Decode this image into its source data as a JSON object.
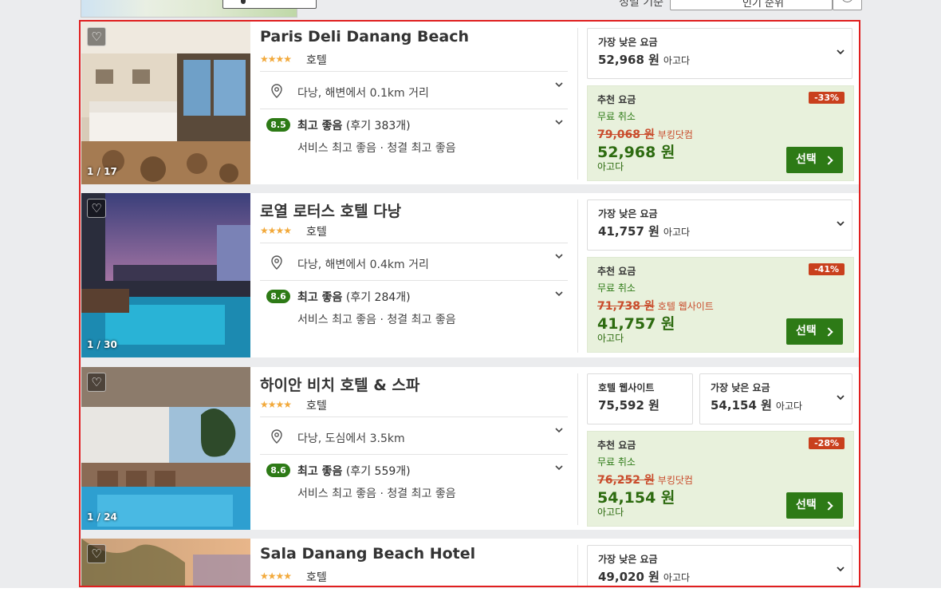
{
  "topbar": {
    "map_button_label": "지도에서 보기",
    "sort_label": "정렬 기준",
    "sort_value": "인기 순위"
  },
  "hotels": [
    {
      "name": "Paris Deli Danang Beach",
      "stars": "★★★★",
      "type": "호텔",
      "photo_counter": "1 / 17",
      "location": "다낭, 해변에서 0.1km 거리",
      "score": "8.5",
      "rating_text": "최고 좋음",
      "review_count": "(후기 383개)",
      "sub_rating": "서비스 최고 좋음 · 청결 최고 좋음",
      "lowest_label": "가장 낮은 요금",
      "lowest_price": "52,968 원",
      "lowest_site": "아고다",
      "rec_label": "추천 요금",
      "discount": "-33%",
      "free_cancel": "무료 취소",
      "old_price": "79,068 원",
      "old_site": "부킹닷컴",
      "price": "52,968 원",
      "site": "아고다",
      "select_label": "선택"
    },
    {
      "name": "로열 로터스 호텔 다낭",
      "stars": "★★★★",
      "type": "호텔",
      "photo_counter": "1 / 30",
      "location": "다낭, 해변에서 0.4km 거리",
      "score": "8.6",
      "rating_text": "최고 좋음",
      "review_count": "(후기 284개)",
      "sub_rating": "서비스 최고 좋음 · 청결 최고 좋음",
      "lowest_label": "가장 낮은 요금",
      "lowest_price": "41,757 원",
      "lowest_site": "아고다",
      "rec_label": "추천 요금",
      "discount": "-41%",
      "free_cancel": "무료 취소",
      "old_price": "71,738 원",
      "old_site": "호텔 웹사이트",
      "price": "41,757 원",
      "site": "아고다",
      "select_label": "선택"
    },
    {
      "name": "하이안 비치 호텔 & 스파",
      "stars": "★★★★",
      "type": "호텔",
      "photo_counter": "1 / 24",
      "location": "다낭, 도심에서 3.5km",
      "score": "8.6",
      "rating_text": "최고 좋음",
      "review_count": "(후기 559개)",
      "sub_rating": "서비스 최고 좋음 · 청결 최고 좋음",
      "site_label": "호텔 웹사이트",
      "site_price": "75,592 원",
      "lowest_label": "가장 낮은 요금",
      "lowest_price": "54,154 원",
      "lowest_site": "아고다",
      "rec_label": "추천 요금",
      "discount": "-28%",
      "free_cancel": "무료 취소",
      "old_price": "76,252 원",
      "old_site": "부킹닷컴",
      "price": "54,154 원",
      "site": "아고다",
      "select_label": "선택"
    },
    {
      "name": "Sala Danang Beach Hotel",
      "stars": "★★★★",
      "type": "호텔",
      "lowest_label": "가장 낮은 요금",
      "lowest_price": "49,020 원",
      "lowest_site": "아고다"
    }
  ],
  "colors": {
    "accent_green": "#2d7a16",
    "discount_red": "#c9401d",
    "highlight_border": "#e01f1f",
    "star_orange": "#f2a93b"
  }
}
